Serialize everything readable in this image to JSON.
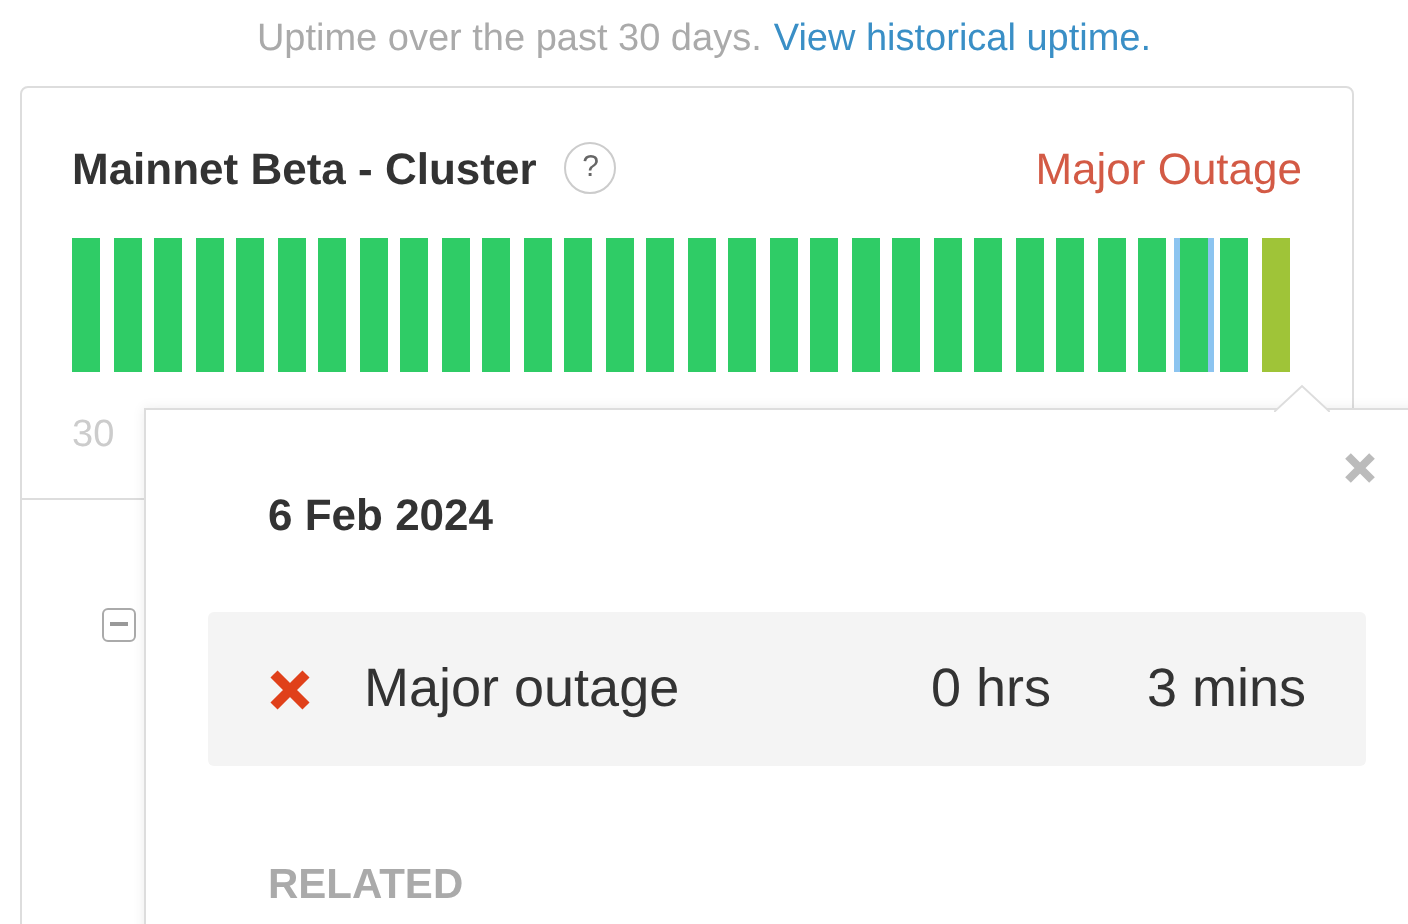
{
  "caption": {
    "text": "Uptime over the past 30 days.",
    "link": "View historical uptime."
  },
  "component": {
    "name": "Mainnet Beta - Cluster",
    "help": "?",
    "status": "Major Outage",
    "axis_start": "30",
    "bars": [
      {
        "color": "#2fcc66",
        "hovered": false
      },
      {
        "color": "#2fcc66",
        "hovered": false
      },
      {
        "color": "#2fcc66",
        "hovered": false
      },
      {
        "color": "#2fcc66",
        "hovered": false
      },
      {
        "color": "#2fcc66",
        "hovered": false
      },
      {
        "color": "#2fcc66",
        "hovered": false
      },
      {
        "color": "#2fcc66",
        "hovered": false
      },
      {
        "color": "#2fcc66",
        "hovered": false
      },
      {
        "color": "#2fcc66",
        "hovered": false
      },
      {
        "color": "#2fcc66",
        "hovered": false
      },
      {
        "color": "#2fcc66",
        "hovered": false
      },
      {
        "color": "#2fcc66",
        "hovered": false
      },
      {
        "color": "#2fcc66",
        "hovered": false
      },
      {
        "color": "#2fcc66",
        "hovered": false
      },
      {
        "color": "#2fcc66",
        "hovered": false
      },
      {
        "color": "#2fcc66",
        "hovered": false
      },
      {
        "color": "#2fcc66",
        "hovered": false
      },
      {
        "color": "#2fcc66",
        "hovered": false
      },
      {
        "color": "#2fcc66",
        "hovered": false
      },
      {
        "color": "#2fcc66",
        "hovered": false
      },
      {
        "color": "#2fcc66",
        "hovered": false
      },
      {
        "color": "#2fcc66",
        "hovered": false
      },
      {
        "color": "#2fcc66",
        "hovered": false
      },
      {
        "color": "#2fcc66",
        "hovered": false
      },
      {
        "color": "#2fcc66",
        "hovered": false
      },
      {
        "color": "#2fcc66",
        "hovered": false
      },
      {
        "color": "#2fcc66",
        "hovered": false
      },
      {
        "color": "#2fcc66",
        "hovered": true
      },
      {
        "color": "#2fcc66",
        "hovered": false
      },
      {
        "color": "#9fc438",
        "hovered": false
      }
    ]
  },
  "popover": {
    "date": "6 Feb 2024",
    "outage": {
      "label": "Major outage",
      "hours": "0 hrs",
      "minutes": "3 mins"
    },
    "related": "RELATED"
  }
}
